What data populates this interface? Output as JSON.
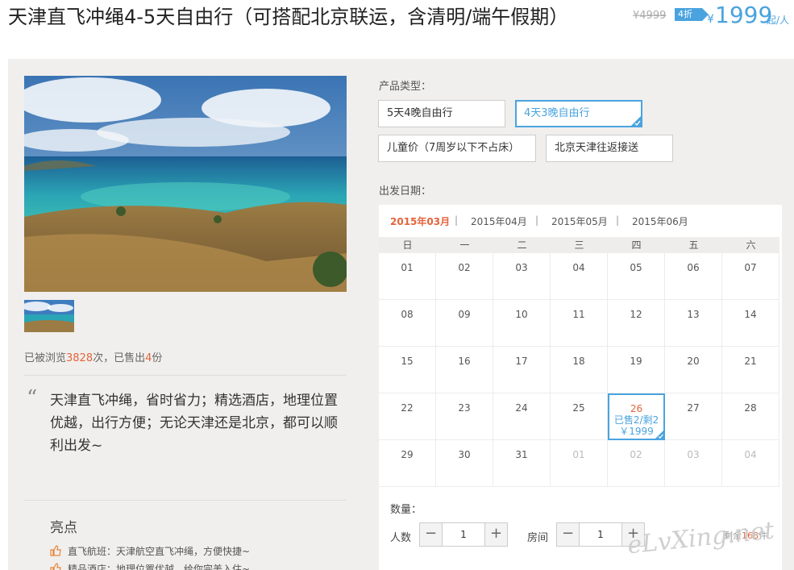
{
  "title": "天津直飞冲绳4-5天自由行（可搭配北京联运，含清明/端午假期）",
  "price": {
    "original": "¥4999",
    "discount": "4折",
    "currency": "¥",
    "current": "1999",
    "per": "起/人"
  },
  "stats": {
    "prefix": "已被浏览",
    "views": "3828",
    "middle": "次，已售出",
    "sold": "4",
    "suffix": "份"
  },
  "description": "天津直飞冲绳，省时省力；精选酒店，地理位置优越，出行方便；无论天津还是北京，都可以顺利出发~",
  "highlights": {
    "title": "亮点",
    "items": [
      "直飞航班：天津航空直飞冲绳，方便快捷~",
      "精品酒店：地理位置优越，给你完美入住~"
    ]
  },
  "product_type": {
    "label": "产品类型：",
    "options": [
      "5天4晚自由行",
      "4天3晚自由行",
      "儿童价（7周岁以下不占床）",
      "北京天津往返接送"
    ],
    "selected": "4天3晚自由行"
  },
  "departure": {
    "label": "出发日期：",
    "months": [
      "2015年03月",
      "2015年04月",
      "2015年05月",
      "2015年06月"
    ],
    "active_month": "2015年03月",
    "weekdays": [
      "日",
      "一",
      "二",
      "三",
      "四",
      "五",
      "六"
    ],
    "days": [
      "01",
      "02",
      "03",
      "04",
      "05",
      "06",
      "07",
      "08",
      "09",
      "10",
      "11",
      "12",
      "13",
      "14",
      "15",
      "16",
      "17",
      "18",
      "19",
      "20",
      "21",
      "22",
      "23",
      "24",
      "25",
      "26",
      "27",
      "28",
      "29",
      "30",
      "31",
      "01",
      "02",
      "03",
      "04"
    ],
    "selected_day": {
      "day": "26",
      "info": "已售2/剩2",
      "price": "￥1999"
    }
  },
  "quantity": {
    "label": "数量：",
    "people_label": "人数",
    "people_value": "1",
    "room_label": "房间",
    "room_value": "1",
    "remain_prefix": "剩余",
    "remain": "168",
    "remain_suffix": "件"
  },
  "icons": {
    "minus": "minus-icon",
    "plus": "plus-icon",
    "thumbs": "thumbs-up-icon",
    "quote": "quote-icon",
    "check": "check-corner-icon"
  },
  "colors": {
    "accent": "#4aa3df",
    "highlight": "#e4643b",
    "panel": "#f0efed"
  },
  "watermark": "eLvXing.net"
}
